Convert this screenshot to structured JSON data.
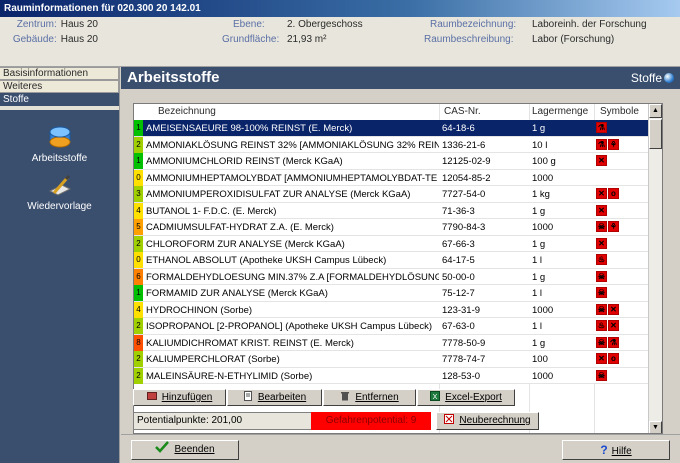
{
  "window": {
    "title": "Rauminformationen für 020.300 20 142.01"
  },
  "info": {
    "zentrum_label": "Zentrum:",
    "zentrum_value": "Haus 20",
    "gebaeude_label": "Gebäude:",
    "gebaeude_value": "Haus 20",
    "ebene_label": "Ebene:",
    "ebene_value": "2. Obergeschoss",
    "grundflaeche_label": "Grundfläche:",
    "grundflaeche_value": "21,93 m²",
    "raumbezeichnung_label": "Raumbezeichnung:",
    "raumbezeichnung_value": "Laboreinh. der Forschung",
    "raumbeschreibung_label": "Raumbeschreibung:",
    "raumbeschreibung_value": "Labor (Forschung)"
  },
  "nav": {
    "tabs": [
      "Basisinformationen",
      "Weiteres",
      "Stoffe"
    ],
    "active_tab": "Stoffe",
    "side_buttons": [
      "Arbeitsstoffe",
      "Wiedervorlage"
    ]
  },
  "main": {
    "title": "Arbeitsstoffe",
    "section_label": "Stoffe",
    "columns": [
      "Bezeichnung",
      "CAS-Nr.",
      "Lagermenge",
      "Symbole"
    ]
  },
  "rows": [
    {
      "num": "1",
      "color": "#00c000",
      "name": "AMEISENSAEURE 98-100% REINST (E. Merck)",
      "cas": "64-18-6",
      "qty": "1 g",
      "symbols": [
        "sym-corrosive"
      ],
      "selected": true
    },
    {
      "num": "2",
      "color": "#a0d000",
      "name": "AMMONIAKLÖSUNG REINST 32% [AMMONIAKLÖSUNG 32% REIN",
      "cas": "1336-21-6",
      "qty": "10 l",
      "symbols": [
        "sym-corrosive",
        "sym-environment"
      ]
    },
    {
      "num": "1",
      "color": "#00c000",
      "name": "AMMONIUMCHLORID REINST (Merck KGaA)",
      "cas": "12125-02-9",
      "qty": "100 g",
      "symbols": [
        "sym-harmful"
      ]
    },
    {
      "num": "0",
      "color": "#ffe000",
      "name": "AMMONIUMHEPTAMOLYBDAT [AMMONIUMHEPTAMOLYBDAT-TE",
      "cas": "12054-85-2",
      "qty": "1000",
      "symbols": []
    },
    {
      "num": "3",
      "color": "#a0d000",
      "name": "AMMONIUMPEROXIDISULFAT ZUR ANALYSE (Merck KGaA)",
      "cas": "7727-54-0",
      "qty": "1 kg",
      "symbols": [
        "sym-harmful",
        "sym-oxidizing"
      ]
    },
    {
      "num": "4",
      "color": "#ffe000",
      "name": "BUTANOL 1- F.D.C. (E. Merck)",
      "cas": "71-36-3",
      "qty": "1 g",
      "symbols": [
        "sym-harmful"
      ]
    },
    {
      "num": "5",
      "color": "#ffa000",
      "name": "CADMIUMSULFAT-HYDRAT Z.A. (E. Merck)",
      "cas": "7790-84-3",
      "qty": "1000",
      "symbols": [
        "sym-toxic",
        "sym-environment"
      ]
    },
    {
      "num": "2",
      "color": "#a0d000",
      "name": "CHLOROFORM ZUR ANALYSE (Merck KGaA)",
      "cas": "67-66-3",
      "qty": "1 g",
      "symbols": [
        "sym-harmful"
      ]
    },
    {
      "num": "0",
      "color": "#ffe000",
      "name": "ETHANOL ABSOLUT (Apotheke UKSH Campus Lübeck)",
      "cas": "64-17-5",
      "qty": "1 l",
      "symbols": [
        "sym-flammable"
      ]
    },
    {
      "num": "6",
      "color": "#ff8000",
      "name": "FORMALDEHYDLOESUNG MIN.37% Z.A [FORMALDEHYDLÖSUNG I",
      "cas": "50-00-0",
      "qty": "1 g",
      "symbols": [
        "sym-toxic"
      ]
    },
    {
      "num": "1",
      "color": "#00c000",
      "name": "FORMAMID ZUR ANALYSE (Merck KGaA)",
      "cas": "75-12-7",
      "qty": "1 l",
      "symbols": [
        "sym-toxic"
      ]
    },
    {
      "num": "4",
      "color": "#ffe000",
      "name": "HYDROCHINON (Sorbe)",
      "cas": "123-31-9",
      "qty": "1000",
      "symbols": [
        "sym-toxic",
        "sym-harmful"
      ]
    },
    {
      "num": "2",
      "color": "#a0d000",
      "name": "ISOPROPANOL [2-PROPANOL] (Apotheke UKSH Campus Lübeck)",
      "cas": "67-63-0",
      "qty": "1 l",
      "symbols": [
        "sym-flammable",
        "sym-harmful"
      ]
    },
    {
      "num": "8",
      "color": "#ff5000",
      "name": "KALIUMDICHROMAT KRIST. REINST (E. Merck)",
      "cas": "7778-50-9",
      "qty": "1 g",
      "symbols": [
        "sym-toxic",
        "sym-corrosive"
      ]
    },
    {
      "num": "2",
      "color": "#a0d000",
      "name": "KALIUMPERCHLORAT (Sorbe)",
      "cas": "7778-74-7",
      "qty": "100",
      "symbols": [
        "sym-harmful",
        "sym-oxidizing"
      ]
    },
    {
      "num": "2",
      "color": "#a0d000",
      "name": "MALEINSÄURE-N-ETHYLIMID (Sorbe)",
      "cas": "128-53-0",
      "qty": "1000",
      "symbols": [
        "sym-toxic"
      ]
    }
  ],
  "actions": {
    "add": "Hinzufügen",
    "edit": "Bearbeiten",
    "remove": "Entfernen",
    "export": "Excel-Export",
    "recalc": "Neuberechnung"
  },
  "summary": {
    "potential_label": "Potentialpunkte: 201,00",
    "danger_label": "Gefahrenpotential: 9",
    "danger_color": "#ff0000"
  },
  "footer": {
    "close": "Beenden",
    "help": "Hilfe"
  }
}
